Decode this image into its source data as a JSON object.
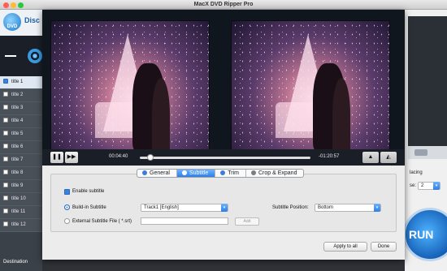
{
  "window": {
    "title": "MacX DVD Ripper Pro"
  },
  "app": {
    "logo_label": "Disc",
    "logo_badge": "DVD",
    "titles": [
      "title 1",
      "title 2",
      "title 3",
      "title 4",
      "title 5",
      "title 6",
      "title 7",
      "title 8",
      "title 9",
      "title 10",
      "title 11",
      "title 12"
    ],
    "selected_title": "title 1",
    "destination_label": "Destination",
    "right_text_1": "lacing",
    "right_text_2": "se:",
    "right_select_value": "2",
    "run_label": "RUN"
  },
  "player": {
    "current_time": "00:04:40",
    "remaining_time": "-01:20:57",
    "progress_fraction": 0.06,
    "play_pause_icon": "pause-icon",
    "forward_icon": "fast-forward-icon"
  },
  "tabs": [
    {
      "label": "General",
      "active": false
    },
    {
      "label": "Subtitle",
      "active": true
    },
    {
      "label": "Trim",
      "active": false
    },
    {
      "label": "Crop & Expand",
      "active": false
    }
  ],
  "subtitle": {
    "enable_label": "Enable subtitle",
    "builtin_label": "Build-in Subtitle",
    "builtin_value": "Track1 [English]",
    "external_label": "External Subtitle File ( *.srt)",
    "add_label": "Add",
    "position_label": "Subtitle Position:",
    "position_value": "Bottom"
  },
  "buttons": {
    "apply_all": "Apply to all",
    "done": "Done"
  }
}
